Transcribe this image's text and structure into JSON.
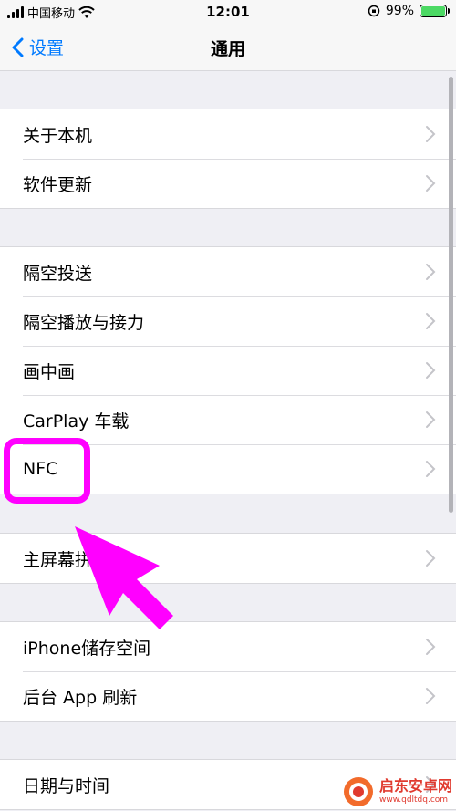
{
  "status_bar": {
    "carrier": "中国移动",
    "time": "12:01",
    "battery": "99%",
    "battery_level": 0.99
  },
  "nav": {
    "back_label": "设置",
    "title": "通用"
  },
  "groups": [
    {
      "items": [
        "关于本机",
        "软件更新"
      ]
    },
    {
      "items": [
        "隔空投送",
        "隔空播放与接力",
        "画中画",
        "CarPlay 车载",
        "NFC"
      ]
    },
    {
      "items": [
        "主屏幕拼"
      ]
    },
    {
      "items": [
        "iPhone储存空间",
        "后台 App 刷新"
      ]
    },
    {
      "items": [
        "日期与时间"
      ]
    }
  ],
  "annotation": {
    "color": "#ff00ff"
  },
  "watermark": {
    "name": "启东安卓网",
    "url": "www.qdltdq.com"
  },
  "colors": {
    "accent": "#007aff",
    "background": "#efeff4",
    "battery": "#4cd964"
  }
}
